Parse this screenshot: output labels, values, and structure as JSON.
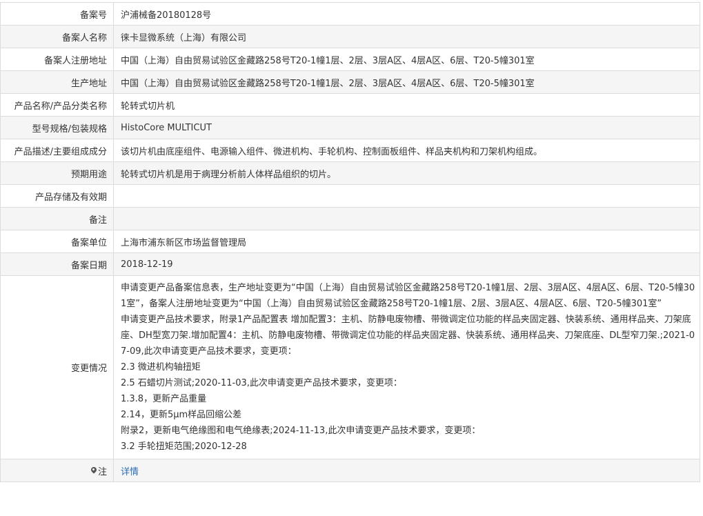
{
  "record": {
    "rows": [
      {
        "label": "备案号",
        "value": "沪浦械备20180128号"
      },
      {
        "label": "备案人名称",
        "value": "徕卡显微系统（上海）有限公司"
      },
      {
        "label": "备案人注册地址",
        "value": "中国（上海）自由贸易试验区金藏路258号T20-1幢1层、2层、3层A区、4层A区、6层、T20-5幢301室"
      },
      {
        "label": "生产地址",
        "value": "中国（上海）自由贸易试验区金藏路258号T20-1幢1层、2层、3层A区、4层A区、6层、T20-5幢301室"
      },
      {
        "label": "产品名称/产品分类名称",
        "value": "轮转式切片机"
      },
      {
        "label": "型号规格/包装规格",
        "value": "HistoCore MULTICUT"
      },
      {
        "label": "产品描述/主要组成成分",
        "value": "该切片机由底座组件、电源输入组件、微进机构、手轮机构、控制面板组件、样品夹机构和刀架机构组成。"
      },
      {
        "label": "预期用途",
        "value": "轮转式切片机是用于病理分析前人体样品组织的切片。"
      },
      {
        "label": "产品存储及有效期",
        "value": ""
      },
      {
        "label": "备注",
        "value": ""
      },
      {
        "label": "备案单位",
        "value": "上海市浦东新区市场监督管理局"
      },
      {
        "label": "备案日期",
        "value": "2018-12-19"
      }
    ],
    "changes": {
      "label": "变更情况",
      "lines": [
        "申请变更产品备案信息表，生产地址变更为“中国（上海）自由贸易试验区金藏路258号T20-1幢1层、2层、3层A区、4层A区、6层、T20-5幢301室”，备案人注册地址变更为“中国（上海）自由贸易试验区金藏路258号T20-1幢1层、2层、3层A区、4层A区、6层、T20-5幢301室”",
        "申请变更产品技术要求，附录1产品配置表 增加配置3：主机、防静电废物槽、带微调定位功能的样品夹固定器、快装系统、通用样品夹、刀架底座、DH型宽刀架.增加配置4：主机、防静电废物槽、带微调定位功能的样品夹固定器、快装系统、通用样品夹、刀架底座、DL型窄刀架.;2021-07-09,此次申请变更产品技术要求，变更项：",
        "2.3 微进机构轴扭矩",
        "2.5 石蜡切片测试;2020-11-03,此次申请变更产品技术要求，变更项：",
        "1.3.8，更新产品重量",
        "2.14，更新5μm样品回缩公差",
        "附录2，更新电气绝缘图和电气绝缘表;2024-11-13,此次申请变更产品技术要求，变更项：",
        "3.2 手轮扭矩范围;2020-12-28"
      ]
    },
    "note": {
      "label": "注",
      "icon": "pin-icon",
      "link_text": "详情"
    }
  }
}
